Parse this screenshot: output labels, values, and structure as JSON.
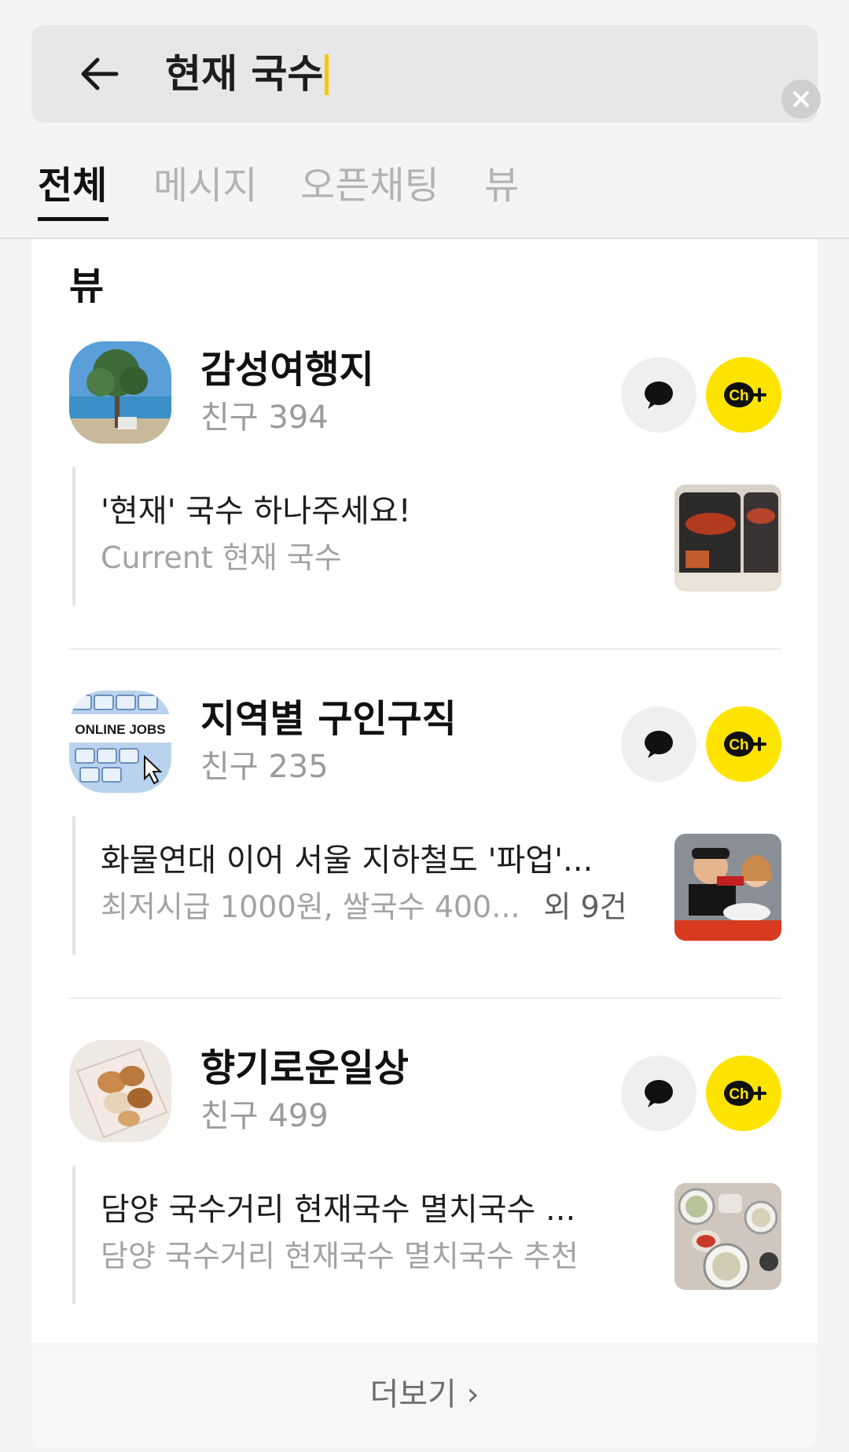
{
  "search": {
    "query": "현재 국수"
  },
  "tabs": [
    {
      "label": "전체",
      "active": true
    },
    {
      "label": "메시지",
      "active": false
    },
    {
      "label": "오픈채팅",
      "active": false
    },
    {
      "label": "뷰",
      "active": false
    }
  ],
  "section": {
    "title": "뷰",
    "more_label": "더보기 ›"
  },
  "results": [
    {
      "name": "감성여행지",
      "friends": "친구 394",
      "post_title": "'현재' 국수 하나주세요!",
      "post_subtitle": "Current 현재 국수",
      "post_extra": ""
    },
    {
      "name": "지역별 구인구직",
      "friends": "친구 235",
      "avatar_text": "ONLINE JOBS",
      "post_title": "화물연대 이어 서울 지하철도 '파업'...",
      "post_subtitle": "최저시급 1000원, 쌀국수 400...",
      "post_extra": "외 9건"
    },
    {
      "name": "향기로운일상",
      "friends": "친구 499",
      "post_title": "담양 국수거리 현재국수 멸치국수 ...",
      "post_subtitle": "담양 국수거리 현재국수 멸치국수 추천",
      "post_extra": ""
    }
  ],
  "buttons": {
    "channel_label": "Ch"
  },
  "colors": {
    "accent_yellow": "#fde400",
    "caret": "#f5c800",
    "muted_text": "#a3a3a3"
  }
}
